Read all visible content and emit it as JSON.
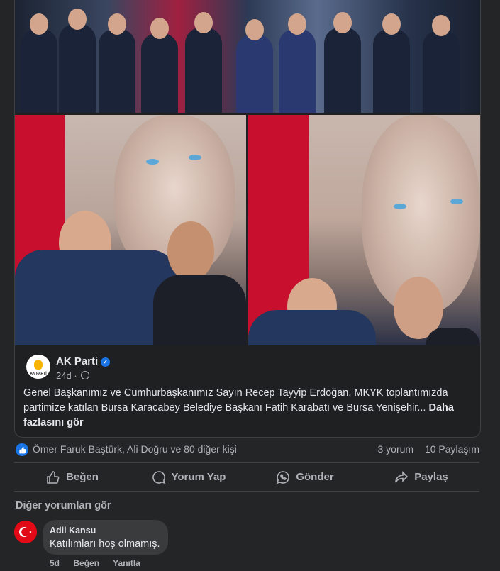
{
  "colors": {
    "background": "#242526",
    "accent": "#1b74e4",
    "card": "#1f2021"
  },
  "post": {
    "page_name": "AK Parti",
    "time": "24d",
    "text": "Genel Başkanımız ve Cumhurbaşkanımız Sayın Recep Tayyip Erdoğan, MKYK toplantımızda partimize katılan Bursa Karacabey Belediye Başkanı Fatih Karabatı ve Bursa Yenişehir...",
    "see_more": "Daha fazlasını gör",
    "logo_text": "AK PARTİ"
  },
  "reactions": {
    "names": "Ömer Faruk Baştürk, Ali Doğru ve 80 diğer kişi",
    "comments": "3 yorum",
    "shares": "10 Paylaşım"
  },
  "actions": {
    "like": "Beğen",
    "comment": "Yorum Yap",
    "send": "Gönder",
    "share": "Paylaş"
  },
  "comments": {
    "more_label": "Diğer yorumları gör",
    "items": [
      {
        "author": "Adil Kansu",
        "text": "Katılımları hoş olmamış.",
        "time": "5d",
        "like": "Beğen",
        "reply": "Yanıtla"
      }
    ]
  }
}
